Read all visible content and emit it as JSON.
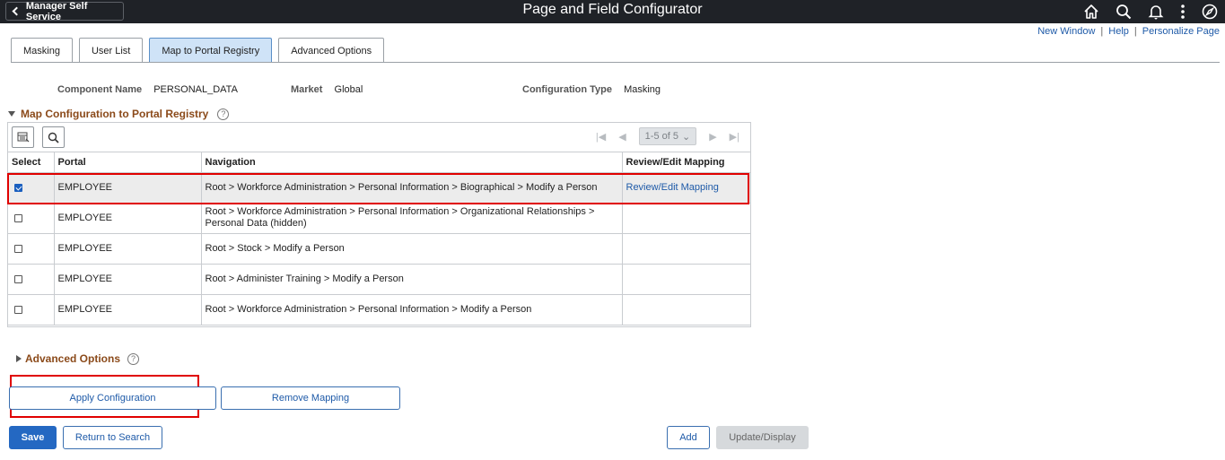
{
  "topbar": {
    "back_label": "Manager Self Service",
    "title": "Page and Field Configurator"
  },
  "icons": [
    "chevron-left-icon",
    "home-icon",
    "search-icon",
    "bell-icon",
    "actions-menu-icon",
    "navbar-compass-icon"
  ],
  "util_links": [
    "New Window",
    "Help",
    "Personalize Page"
  ],
  "tabs": [
    {
      "label": "Masking",
      "active": false
    },
    {
      "label": "User List",
      "active": false
    },
    {
      "label": "Map to Portal Registry",
      "active": true
    },
    {
      "label": "Advanced Options",
      "active": false
    }
  ],
  "info": {
    "component_label": "Component Name",
    "component_value": "PERSONAL_DATA",
    "market_label": "Market",
    "market_value": "Global",
    "config_type_label": "Configuration Type",
    "config_type_value": "Masking"
  },
  "section": {
    "title": "Map Configuration to Portal Registry",
    "help": "?"
  },
  "pager": {
    "range": "1-5 of 5"
  },
  "grid": {
    "headers": [
      "Select",
      "Portal",
      "Navigation",
      "Review/Edit Mapping"
    ],
    "rows": [
      {
        "checked": true,
        "portal": "EMPLOYEE",
        "navigation": "Root > Workforce Administration > Personal Information > Biographical > Modify a Person",
        "mapping": "Review/Edit Mapping"
      },
      {
        "checked": false,
        "portal": "EMPLOYEE",
        "navigation": "Root > Workforce Administration > Personal Information > Organizational Relationships > Personal Data (hidden)",
        "mapping": ""
      },
      {
        "checked": false,
        "portal": "EMPLOYEE",
        "navigation": "Root > Stock > Modify a Person",
        "mapping": ""
      },
      {
        "checked": false,
        "portal": "EMPLOYEE",
        "navigation": "Root > Administer Training > Modify a Person",
        "mapping": ""
      },
      {
        "checked": false,
        "portal": "EMPLOYEE",
        "navigation": "Root > Workforce Administration > Personal Information > Modify a Person",
        "mapping": ""
      }
    ]
  },
  "advanced": {
    "title": "Advanced Options",
    "help": "?"
  },
  "buttons": {
    "apply": "Apply Configuration",
    "remove": "Remove Mapping",
    "save": "Save",
    "return": "Return to Search",
    "add": "Add",
    "update": "Update/Display"
  },
  "colors": {
    "topbar": "#1f2227",
    "accent": "#1e5aa8",
    "section_title": "#8b4a1a",
    "highlight_box": "#e00000"
  }
}
